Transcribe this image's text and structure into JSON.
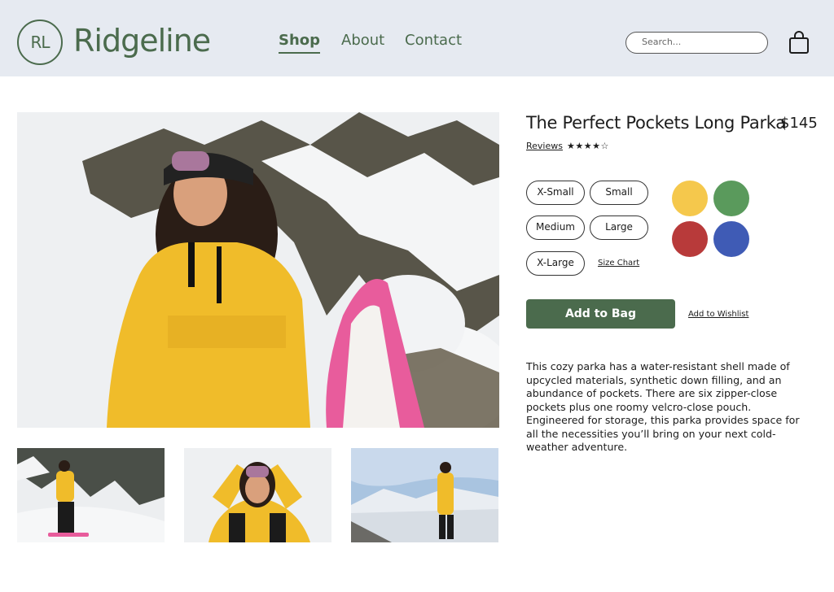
{
  "brand": {
    "monogram": "RL",
    "name": "Ridgeline",
    "color": "#4b6b4d"
  },
  "nav": {
    "items": [
      {
        "label": "Shop",
        "active": true
      },
      {
        "label": "About",
        "active": false
      },
      {
        "label": "Contact",
        "active": false
      }
    ]
  },
  "search": {
    "placeholder": "Search..."
  },
  "header": {
    "background": "#e6eaf1",
    "cart_icon": "shopping-bag-icon"
  },
  "product": {
    "title": "The Perfect Pockets Long Parka",
    "price": "$145",
    "reviews_label": "Reviews",
    "rating_stars": "★★★★☆",
    "rating": 4,
    "rating_max": 5,
    "sizes": [
      "X-Small",
      "Small",
      "Medium",
      "Large",
      "X-Large"
    ],
    "size_chart_label": "Size Chart",
    "colors": [
      {
        "name": "yellow",
        "hex": "#f5c84c"
      },
      {
        "name": "green",
        "hex": "#5a9a5c"
      },
      {
        "name": "red",
        "hex": "#b83a3a"
      },
      {
        "name": "blue",
        "hex": "#3f5bb5"
      }
    ],
    "add_to_bag_label": "Add to Bag",
    "add_to_bag_color": "#4b6b4d",
    "wishlist_label": "Add to Wishlist",
    "description": "This cozy parka has a water-resistant shell made of upcycled materials, synthetic down filling, and an abundance of pockets. There are six zipper-close pockets plus one roomy velcro-close pouch. Engineered for storage, this parka provides space for all the necessities you’ll bring on your next cold-weather adventure."
  },
  "gallery": {
    "main": "woman-yellow-parka-snowy-tree-photo",
    "thumbnails": [
      "snowboarder-forest-thumbnail",
      "woman-goggles-thumbnail",
      "woman-mountain-view-thumbnail"
    ]
  }
}
